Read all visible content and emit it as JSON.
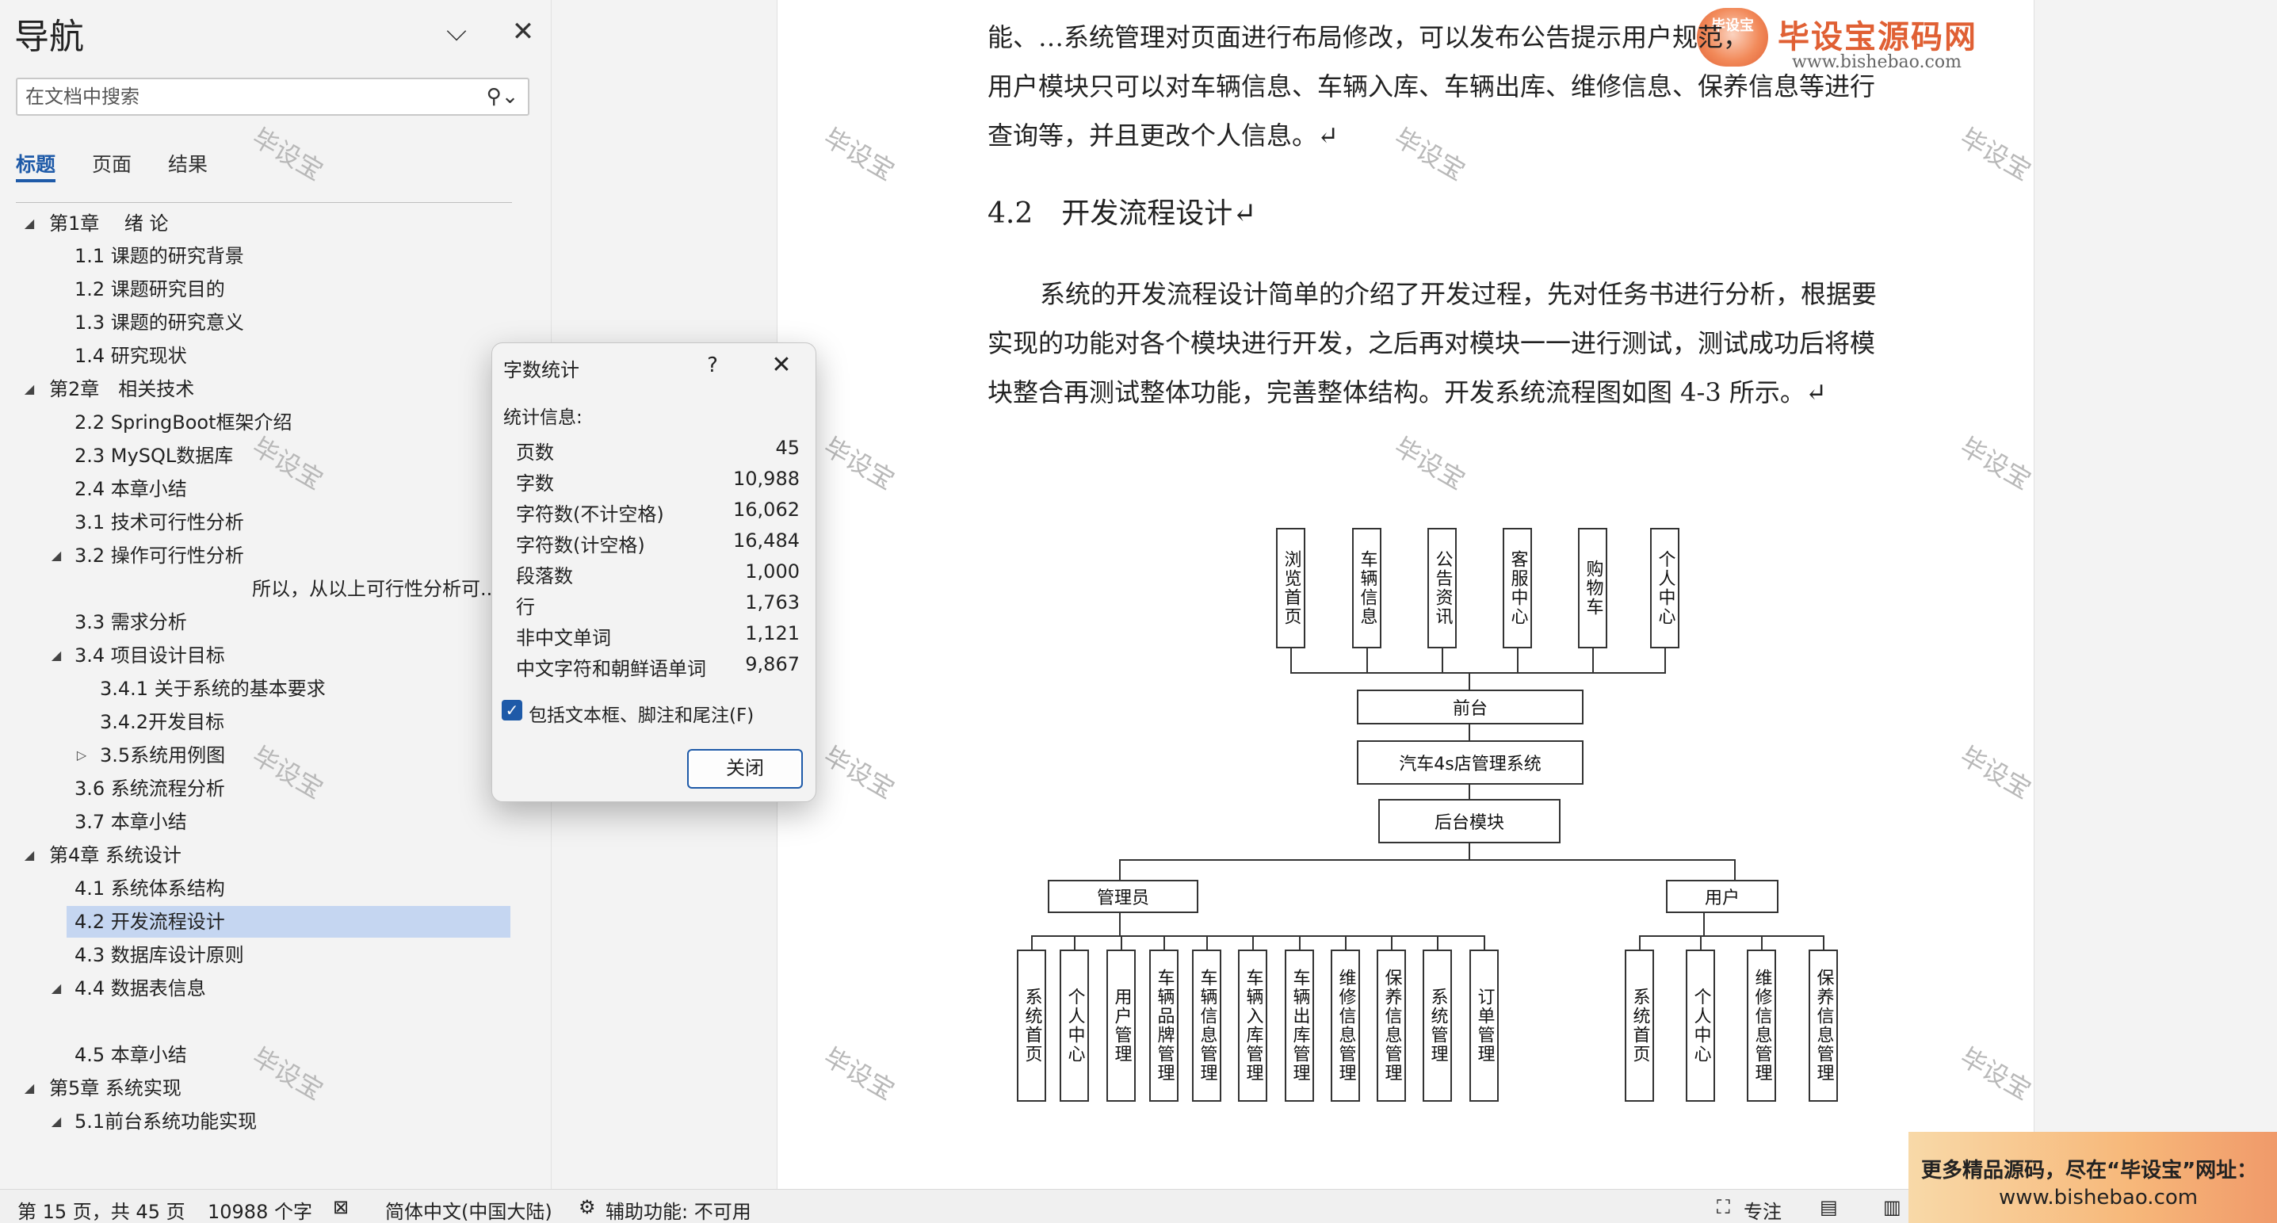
{
  "nav": {
    "title": "导航",
    "search_placeholder": "在文档中搜索",
    "tabs": [
      "标题",
      "页面",
      "结果"
    ],
    "tree": [
      {
        "label": "第1章　 绪 论",
        "caret": "◢"
      },
      {
        "label": "1.1 课题的研究背景",
        "caret": ""
      },
      {
        "label": "1.2 课题研究目的",
        "caret": ""
      },
      {
        "label": "1.3 课题的研究意义",
        "caret": ""
      },
      {
        "label": "1.4 研究现状",
        "caret": ""
      },
      {
        "label": "第2章　相关技术",
        "caret": "◢"
      },
      {
        "label": "2.2  SpringBoot框架介绍",
        "caret": ""
      },
      {
        "label": "2.3  MySQL数据库",
        "caret": ""
      },
      {
        "label": "2.4 本章小结",
        "caret": ""
      },
      {
        "label": "3.1 技术可行性分析",
        "caret": ""
      },
      {
        "label": "3.2  操作可行性分析",
        "caret": "◢"
      },
      {
        "label": "所以，从以上可行性分析可...",
        "caret": ""
      },
      {
        "label": "3.3 需求分析",
        "caret": ""
      },
      {
        "label": "3.4 项目设计目标",
        "caret": "◢"
      },
      {
        "label": "3.4.1 关于系统的基本要求",
        "caret": ""
      },
      {
        "label": "3.4.2开发目标",
        "caret": ""
      },
      {
        "label": "3.5系统用例图",
        "caret": "▷"
      },
      {
        "label": "3.6 系统流程分析",
        "caret": ""
      },
      {
        "label": "3.7  本章小结",
        "caret": ""
      },
      {
        "label": "第4章  系统设计",
        "caret": "◢"
      },
      {
        "label": "4.1 系统体系结构",
        "caret": ""
      },
      {
        "label": "4.2  开发流程设计",
        "caret": ""
      },
      {
        "label": "4.3  数据库设计原则",
        "caret": ""
      },
      {
        "label": "4.4  数据表信息",
        "caret": "◢"
      },
      {
        "label": "4.5  本章小结",
        "caret": ""
      },
      {
        "label": "第5章  系统实现",
        "caret": "◢"
      },
      {
        "label": "5.1前台系统功能实现",
        "caret": "◢"
      }
    ],
    "selected_item": "4.2  开发流程设计"
  },
  "doc": {
    "line1": "能、…系统管理对页面进行布局修改，可以发布公告提示用户规范，",
    "line2": "用户模块只可以对车辆信息、车辆入库、车辆出库、维修信息、保养信息等进行",
    "line3": "查询等，并且更改个人信息。↵",
    "heading": "4.2　开发流程设计↵",
    "p1": "系统的开发流程设计简单的介绍了开发过程，先对任务书进行分析，根据要",
    "p2": "实现的功能对各个模块进行开发，之后再对模块一一进行测试，测试成功后将模",
    "p3": "块整合再测试整体功能，完善整体结构。开发系统流程图如图 4-3 所示。↵",
    "watermark": "毕设宝",
    "logo_badge": "毕设宝",
    "logo_name": "毕设宝源码网",
    "logo_url": "www.bishebao.com"
  },
  "diagram": {
    "front_modules": [
      "浏览首页",
      "车辆信息",
      "公告资讯",
      "客服中心",
      "购物车",
      "个人中心"
    ],
    "front": "前台",
    "system": "汽车4s店管理系统",
    "backend": "后台模块",
    "admin": "管理员",
    "user": "用户",
    "admin_modules": [
      "系统首页",
      "个人中心",
      "用户管理",
      "车辆品牌管理",
      "车辆信息管理",
      "车辆入库管理",
      "车辆出库管理",
      "维修信息管理",
      "保养信息管理",
      "系统管理",
      "订单管理"
    ],
    "user_modules": [
      "系统首页",
      "个人中心",
      "维修信息管理",
      "保养信息管理"
    ]
  },
  "dialog": {
    "title": "字数统计",
    "help": "?",
    "close": "✕",
    "header": "统计信息:",
    "stats": [
      {
        "k": "页数",
        "v": "45"
      },
      {
        "k": "字数",
        "v": "10,988"
      },
      {
        "k": "字符数(不计空格)",
        "v": "16,062"
      },
      {
        "k": "字符数(计空格)",
        "v": "16,484"
      },
      {
        "k": "段落数",
        "v": "1,000"
      },
      {
        "k": "行",
        "v": "1,763"
      },
      {
        "k": "非中文单词",
        "v": "1,121"
      },
      {
        "k": "中文字符和朝鲜语单词",
        "v": "9,867"
      }
    ],
    "checkbox_label": "包括文本框、脚注和尾注(F)",
    "checkbox_checked": true,
    "button": "关闭"
  },
  "status": {
    "page": "第 15 页，共 45 页",
    "words": "10988 个字",
    "language": "简体中文(中国大陆)",
    "accessibility": "辅助功能: 不可用",
    "focus": "专注"
  },
  "ad": {
    "line1": "更多精品源码，尽在“毕设宝”网址：",
    "line2": "www.bishebao.com"
  },
  "colors": {
    "accent": "#1e5aa8",
    "selected": "#c5d6f1",
    "logo": "#e06034"
  }
}
